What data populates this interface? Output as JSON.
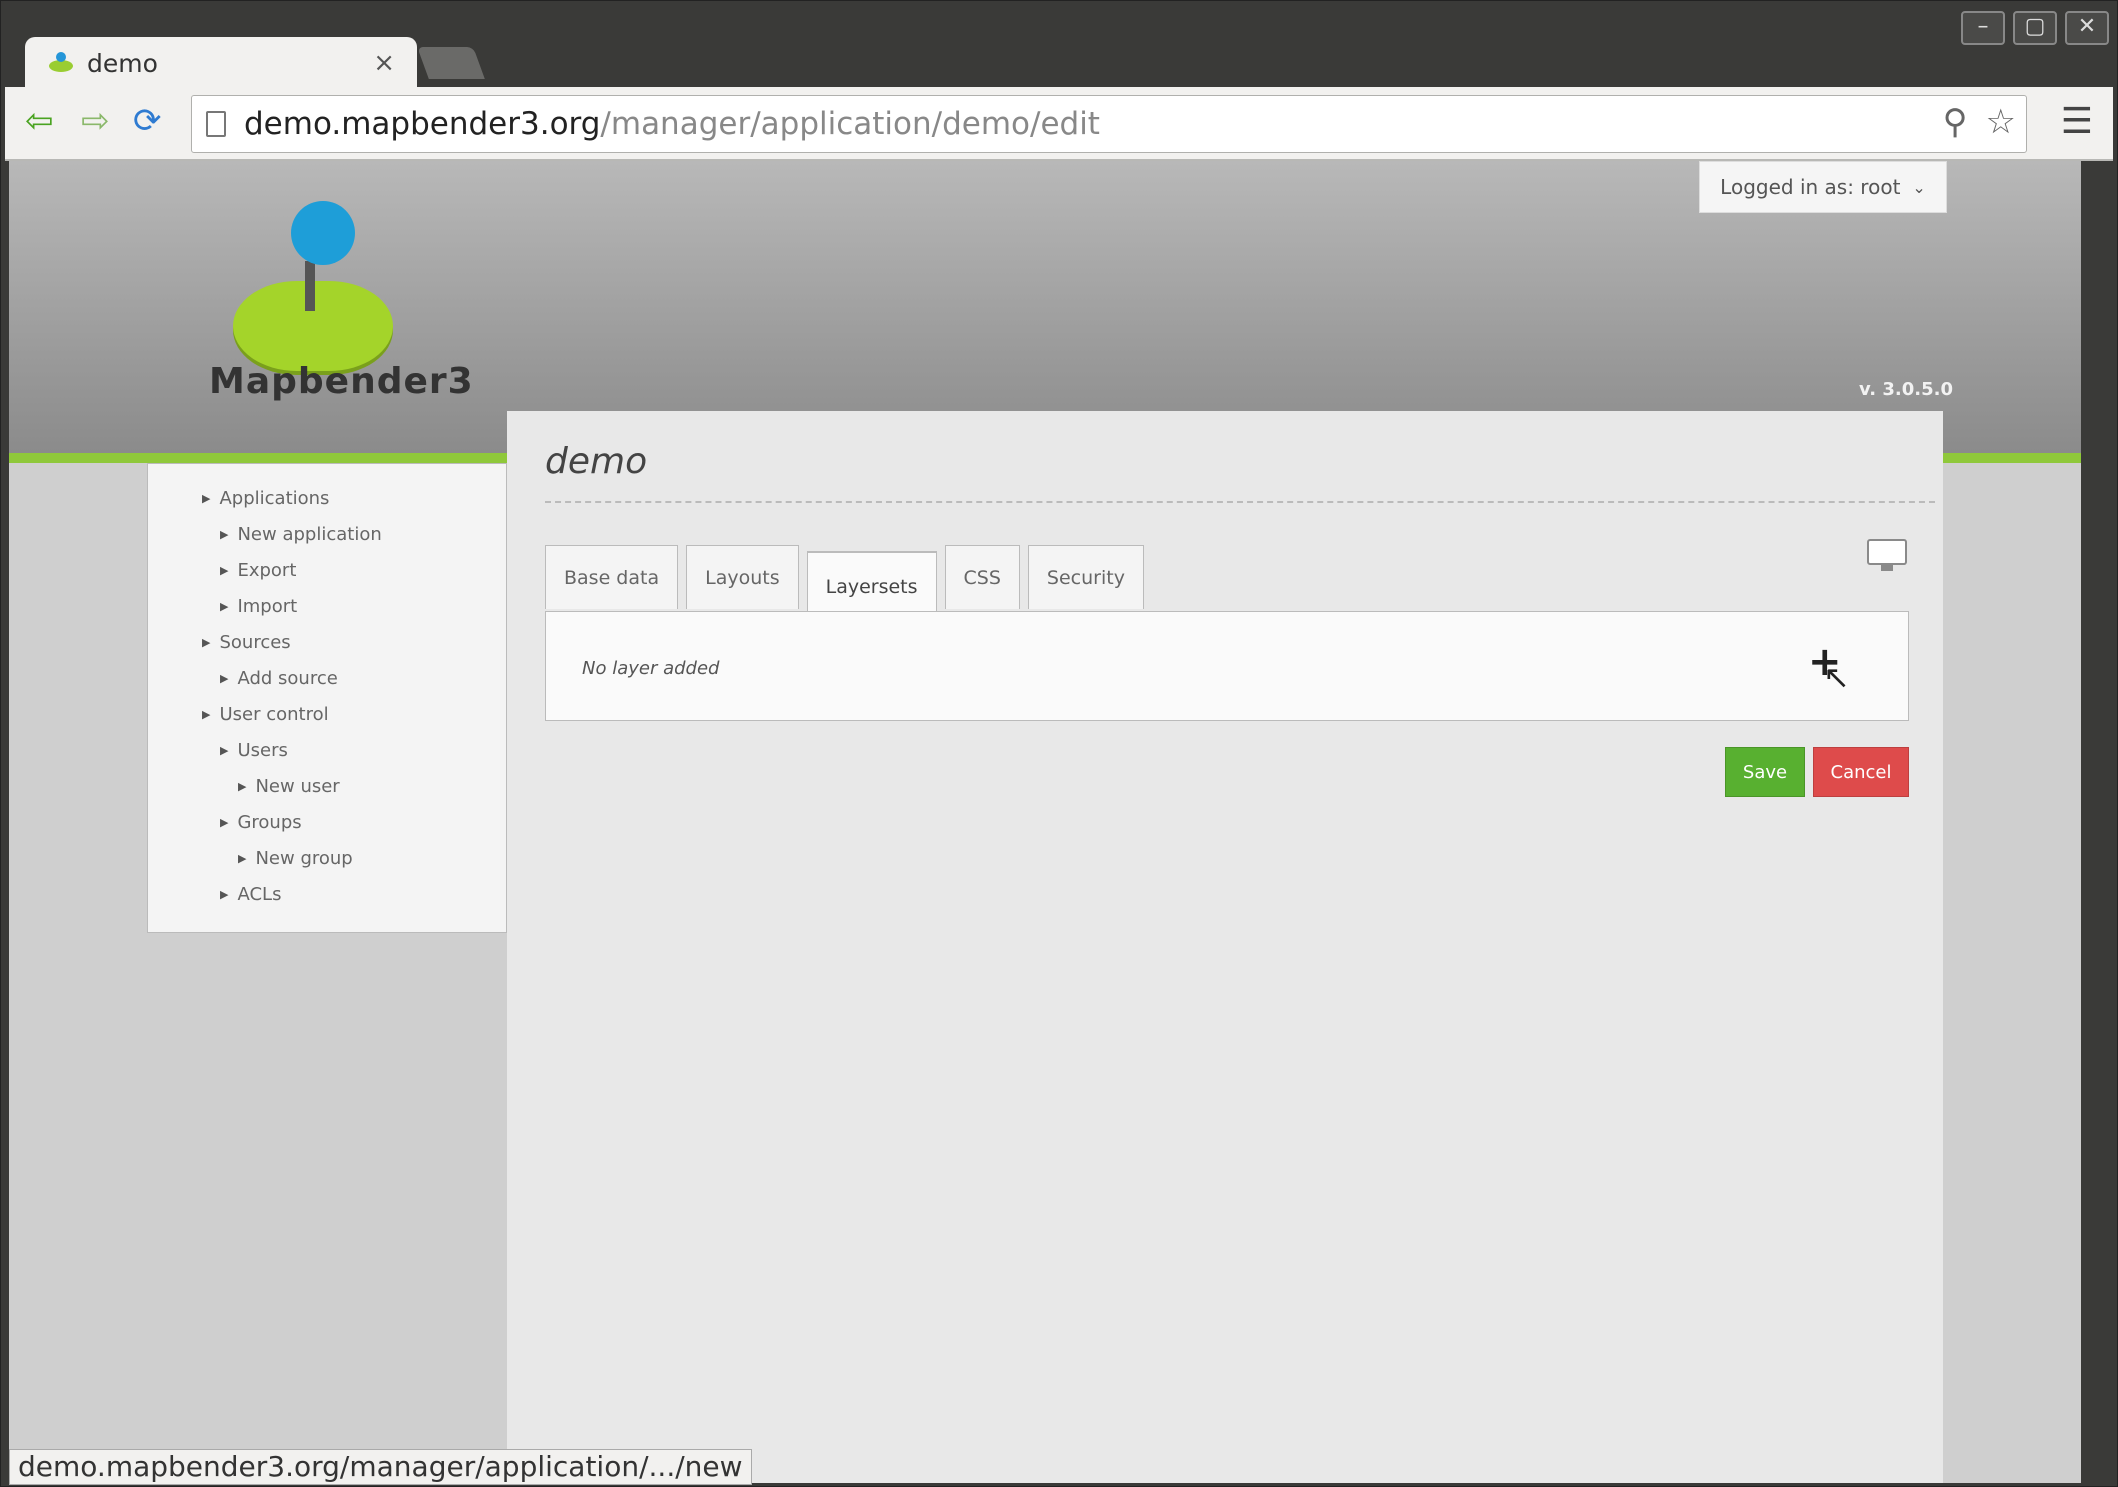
{
  "browser": {
    "tab_title": "demo",
    "tab_close": "×",
    "url_host": "demo.mapbender3.org",
    "url_path": "/manager/application/demo/edit",
    "status_url": "demo.mapbender3.org/manager/application/.../new"
  },
  "header": {
    "logo_text": "Mapbender3",
    "version": "v. 3.0.5.0",
    "user_menu": "Logged in as: root"
  },
  "sidebar": {
    "items": [
      {
        "label": "Applications",
        "level": 0
      },
      {
        "label": "New application",
        "level": 1
      },
      {
        "label": "Export",
        "level": 1
      },
      {
        "label": "Import",
        "level": 1
      },
      {
        "label": "Sources",
        "level": 0
      },
      {
        "label": "Add source",
        "level": 1
      },
      {
        "label": "User control",
        "level": 0
      },
      {
        "label": "Users",
        "level": 1
      },
      {
        "label": "New user",
        "level": 2
      },
      {
        "label": "Groups",
        "level": 1
      },
      {
        "label": "New group",
        "level": 2
      },
      {
        "label": "ACLs",
        "level": 1
      }
    ]
  },
  "main": {
    "title": "demo",
    "tabs": [
      {
        "label": "Base data"
      },
      {
        "label": "Layouts"
      },
      {
        "label": "Layersets",
        "active": true
      },
      {
        "label": "CSS"
      },
      {
        "label": "Security"
      }
    ],
    "empty_message": "No layer added",
    "add_icon": "plus-icon",
    "save_label": "Save",
    "cancel_label": "Cancel"
  },
  "colors": {
    "brand_green": "#8fc83a",
    "save": "#58b030",
    "cancel": "#de4b4b"
  }
}
